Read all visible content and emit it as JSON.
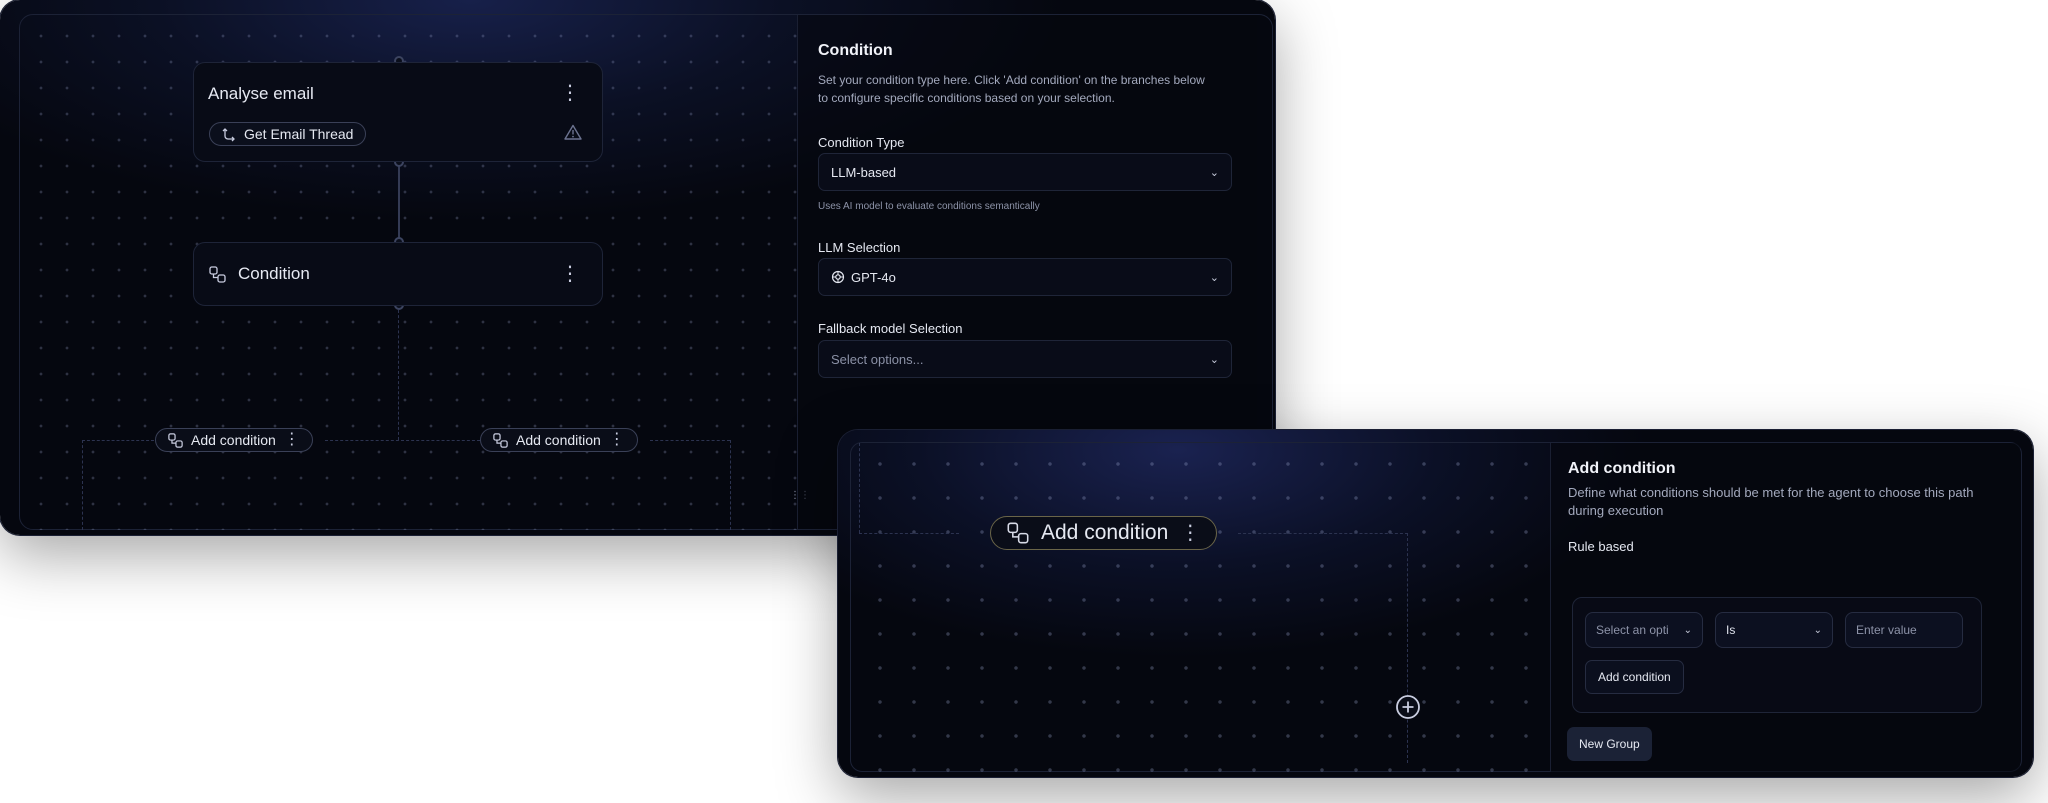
{
  "workflow": {
    "node_analyse": {
      "title": "Analyse email",
      "tool_tag": "Get Email Thread"
    },
    "node_condition": {
      "title": "Condition"
    },
    "branches": [
      {
        "label": "Add condition"
      },
      {
        "label": "Add condition"
      }
    ]
  },
  "condition_panel": {
    "title": "Condition",
    "description": "Set your condition type here. Click 'Add condition' on the branches below to configure specific conditions based on your selection.",
    "condition_type": {
      "label": "Condition Type",
      "value": "LLM-based",
      "hint": "Uses AI model to evaluate conditions semantically"
    },
    "llm_selection": {
      "label": "LLM Selection",
      "value": "GPT-4o"
    },
    "fallback": {
      "label": "Fallback model Selection",
      "placeholder": "Select options..."
    }
  },
  "zoom_view": {
    "branch_label": "Add condition"
  },
  "add_condition_panel": {
    "title": "Add condition",
    "description": "Define what conditions should be met for the agent to choose this path during execution",
    "rule_label": "Rule based",
    "field_select": {
      "placeholder": "Select an opti"
    },
    "operator_select": {
      "value": "Is"
    },
    "value_input": {
      "placeholder": "Enter value"
    },
    "add_condition_button": "Add condition",
    "new_group_button": "New Group"
  },
  "icons": [
    "branch-icon",
    "kebab-icon",
    "tool-icon",
    "warning-icon",
    "chevron-down-icon",
    "openai-icon",
    "plus-circle-icon",
    "drag-handle-icon"
  ],
  "colors": {
    "background": "#060914",
    "border": "#1e2438",
    "text": "#e6e9f2",
    "muted": "#a3a9bd"
  }
}
